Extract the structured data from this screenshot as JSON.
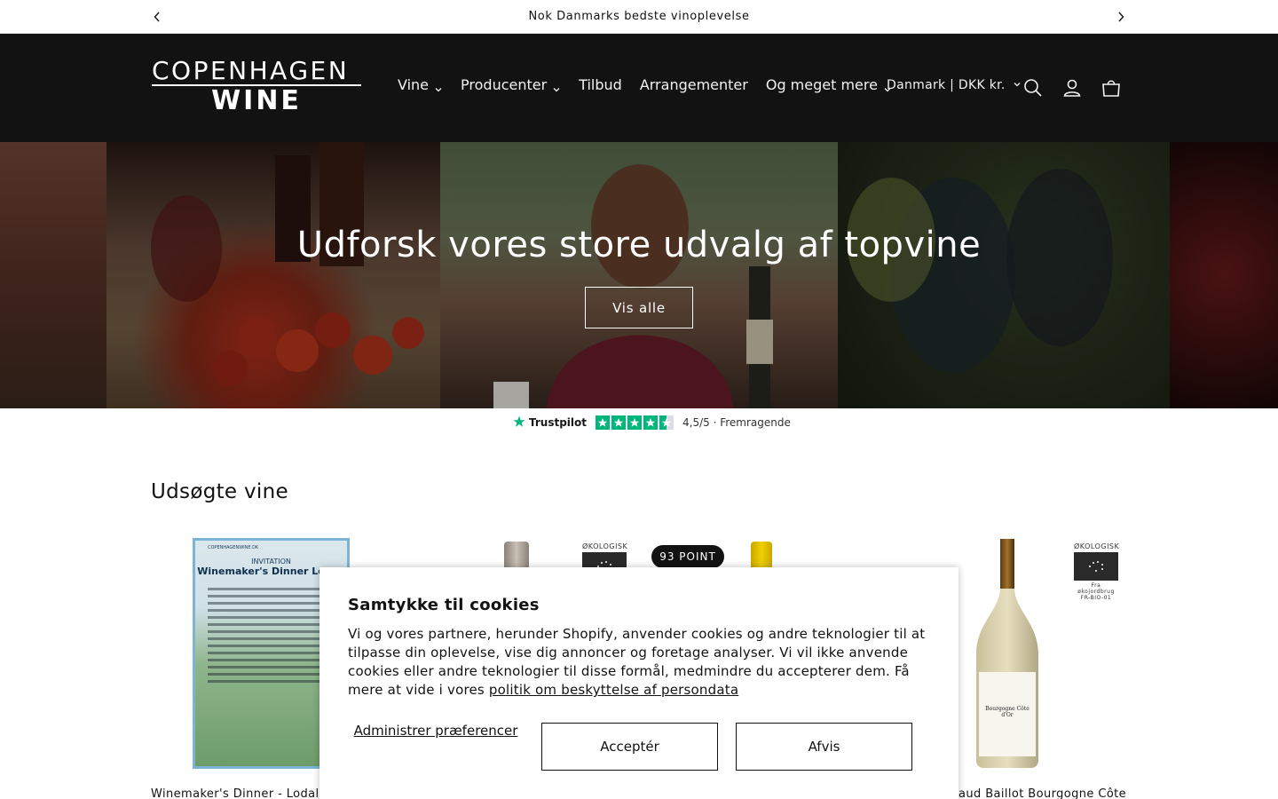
{
  "announcement": {
    "text": "Nok Danmarks bedste vinoplevelse"
  },
  "header": {
    "logo_line1": "COPENHAGEN",
    "logo_line2": "WINE",
    "nav": [
      "Vine",
      "Producenter",
      "Tilbud",
      "Arrangementer",
      "Og meget mere"
    ],
    "locale": "Danmark | DKK kr."
  },
  "hero": {
    "title": "Udforsk vores store udvalg af topvine",
    "cta": "Vis alle"
  },
  "trustpilot": {
    "brand": "Trustpilot",
    "rating_text": "4,5/5 · Fremragende",
    "stars": 4.5
  },
  "featured": {
    "title": "Udsøgte vine",
    "eco_label": "ØKOLOGISK",
    "point_badge": "93 POINT",
    "eco_sub": "Fra økojordbrug FR-BIO-01",
    "poster": {
      "site": "COPENHAGENWINE.DK",
      "invitation": "INVITATION",
      "headline": "Winemaker's Dinner Lodali"
    },
    "products": [
      {
        "title": "Winemaker's Dinner - Lodali - En"
      },
      {
        "title": "aud Baillot Bourgogne Côte"
      }
    ],
    "bottle_label": "Bourgogne Côte d'Or"
  },
  "cookie": {
    "title": "Samtykke til cookies",
    "body": "Vi og vores partnere, herunder Shopify, anvender cookies og andre teknologier til at tilpasse din oplevelse, vise dig annoncer og foretage analyser. Vi vil ikke anvende cookies eller andre teknologier til disse formål, medmindre du accepterer dem. Få mere at vide i vores ",
    "link": "politik om beskyttelse af persondata",
    "manage": "Administrer præferencer",
    "accept": "Acceptér",
    "decline": "Afvis"
  },
  "colors": {
    "header_bg": "#121212",
    "trustpilot_green": "#00b67a",
    "text": "#121212"
  }
}
